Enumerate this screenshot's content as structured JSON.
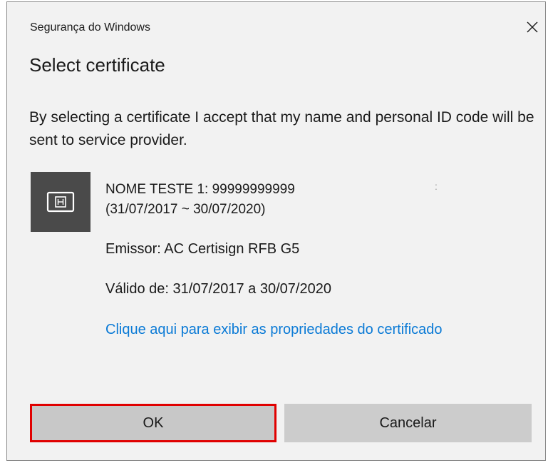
{
  "window": {
    "title": "Segurança do Windows",
    "close_icon": "close-icon"
  },
  "dialog": {
    "heading": "Select certificate",
    "description": "By selecting a certificate I accept that my name and personal ID code will be sent to service provider."
  },
  "certificate": {
    "icon": "certificate-card-icon",
    "name_line1": "NOME TESTE 1:  99999999999",
    "name_line2": "(31/07/2017 ~ 30/07/2020)",
    "issuer": "Emissor: AC Certisign RFB G5",
    "validity": "Válido de: 31/07/2017 a 30/07/2020",
    "properties_link": "Clique aqui para exibir as propriedades do certificado"
  },
  "buttons": {
    "ok_label": "OK",
    "cancel_label": "Cancelar"
  },
  "colors": {
    "dialog_background": "#f2f2f2",
    "link": "#0a7ad6",
    "button_background": "#cccccc",
    "highlight_border": "#e00000",
    "tile_background": "#4a4a4a"
  }
}
